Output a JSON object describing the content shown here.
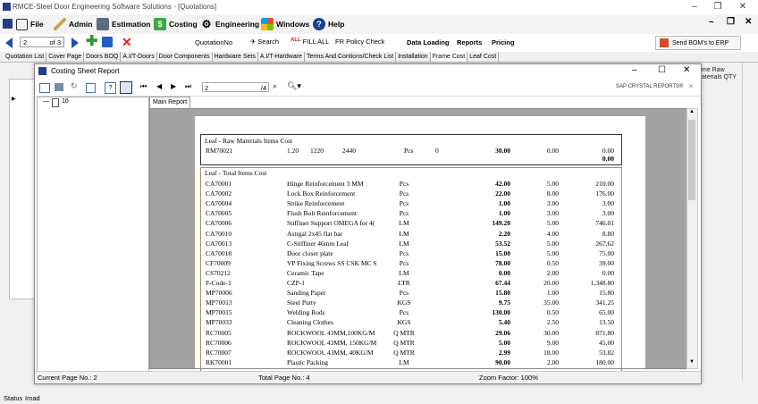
{
  "app": {
    "title": "RMCE-Steel Door Engineering Software Solutions - [Quotations]",
    "menu": [
      {
        "label": "File",
        "icon": "file-icon"
      },
      {
        "label": "Admin",
        "icon": "pen-icon"
      },
      {
        "label": "Estimation",
        "icon": "calculator-icon"
      },
      {
        "label": "Costing",
        "icon": "dollar-icon"
      },
      {
        "label": "Engineering",
        "icon": "gear-icon"
      },
      {
        "label": "Windows",
        "icon": "windows-icon"
      },
      {
        "label": "Help",
        "icon": "help-icon"
      }
    ]
  },
  "toolbar": {
    "page_value": "2",
    "page_of": "of 3",
    "quotation_label": "QuotationNo",
    "search_label": "Search",
    "fill_all_label": "FILL ALL",
    "fr_policy_label": "FR Policy Check",
    "data_loading_label": "Data Loading",
    "reports_label": "Reports",
    "pricing_label": "Pricing",
    "send_bom_label": "Send BOM's to ERP"
  },
  "tabs": [
    "Quotation List",
    "Cover Page",
    "Doors BOQ",
    "A.I/T-Doors",
    "Door Components",
    "Hardware Sets",
    "A.I/T-Hardware",
    "Terms And Contions/Check List",
    "Installation",
    "Frame Cost",
    "Leaf Cost"
  ],
  "active_tab_index": 9,
  "right_panel_text": "me Raw\naterials QTY",
  "status": {
    "label": "Status",
    "user": "Imad"
  },
  "dialog": {
    "title": "Costing Sheet Report",
    "page_value": "2",
    "page_total": "/4",
    "brand": "SAP CRYSTAL REPORTS®",
    "tree_item": "16",
    "view_tab": "Main Report",
    "status_current": "Current Page No.: 2",
    "status_total": "Total Page No.: 4",
    "status_zoom": "Zoom Factor: 100%"
  },
  "report": {
    "raw_section": {
      "title": "Leaf - Raw Materials Items Cost",
      "row": {
        "code": "RM70021",
        "w": "1.20",
        "l": "1220",
        "h": "2440",
        "unit": "Pcs",
        "n": "0",
        "qty": "30.00",
        "rate": "0.00",
        "amt": "0.00"
      },
      "total": "0.00"
    },
    "total_section": {
      "title": "Leaf - Total Items Cost",
      "rows": [
        {
          "code": "CA70001",
          "desc": "Hinge Reinforcement 3 MM",
          "unit": "Pcs",
          "qty": "42.00",
          "rate": "5.00",
          "amt": "210.00"
        },
        {
          "code": "CA70002",
          "desc": "Lock Box Reinforcement",
          "unit": "Pcs",
          "qty": "22.00",
          "rate": "8.00",
          "amt": "176.00"
        },
        {
          "code": "CA70004",
          "desc": "Strike Reinforcement",
          "unit": "Pcs",
          "qty": "1.00",
          "rate": "3.00",
          "amt": "3.00"
        },
        {
          "code": "CA70005",
          "desc": "Flush Bolt Reinforcement",
          "unit": "Pcs",
          "qty": "1.00",
          "rate": "3.00",
          "amt": "3.00"
        },
        {
          "code": "CA70006",
          "desc": "Stiffiner Support OMEGA for 4(",
          "unit": "LM",
          "qty": "149.20",
          "rate": "5.00",
          "amt": "746.01"
        },
        {
          "code": "CA70010",
          "desc": "Astrgal 2x45 flat bar",
          "unit": "LM",
          "qty": "2.20",
          "rate": "4.00",
          "amt": "8.80"
        },
        {
          "code": "CA70013",
          "desc": "C-Stiffiner 46mm Leaf",
          "unit": "LM",
          "qty": "53.52",
          "rate": "5.00",
          "amt": "267.62"
        },
        {
          "code": "CA70018",
          "desc": "Door closer plate",
          "unit": "Pcs",
          "qty": "15.00",
          "rate": "5.00",
          "amt": "75.00"
        },
        {
          "code": "CF70009",
          "desc": "VP Fixing Screws SS CSK MC S",
          "unit": "Pcs",
          "qty": "78.00",
          "rate": "0.50",
          "amt": "39.00"
        },
        {
          "code": "CS70212",
          "desc": "Ceramic Tape",
          "unit": "LM",
          "qty": "0.00",
          "rate": "2.00",
          "amt": "0.00"
        },
        {
          "code": "F-Code-1",
          "desc": "CZP-1",
          "unit": "LTR",
          "qty": "67.44",
          "rate": "20.00",
          "amt": "1,348.80"
        },
        {
          "code": "MP70006",
          "desc": "Sanding Paper",
          "unit": "Pcs",
          "qty": "15.80",
          "rate": "1.00",
          "amt": "15.80"
        },
        {
          "code": "MP70013",
          "desc": "Steel Putty",
          "unit": "KGS",
          "qty": "9.75",
          "rate": "35.00",
          "amt": "341.25"
        },
        {
          "code": "MP70015",
          "desc": "Welding Rods",
          "unit": "Pcs",
          "qty": "130.00",
          "rate": "0.50",
          "amt": "65.00"
        },
        {
          "code": "MP70033",
          "desc": "Cleaning Clothes",
          "unit": "KGS",
          "qty": "5.40",
          "rate": "2.50",
          "amt": "13.50"
        },
        {
          "code": "RC70005",
          "desc": "ROCKWOOL 43MM,100KG/M",
          "unit": "Q MTR",
          "qty": "29.06",
          "rate": "30.00",
          "amt": "871.80"
        },
        {
          "code": "RC70006",
          "desc": "ROCKWOOL 43MM, 150KG/M",
          "unit": "Q MTR",
          "qty": "5.00",
          "rate": "9.00",
          "amt": "45.00"
        },
        {
          "code": "RC70007",
          "desc": "ROCKWOOL 43MM, 40KG/M",
          "unit": "Q MTR",
          "qty": "2.99",
          "rate": "18.00",
          "amt": "53.82"
        },
        {
          "code": "RK70001",
          "desc": "Plastic Packing",
          "unit": "LM",
          "qty": "90.00",
          "rate": "2.00",
          "amt": "180.00"
        }
      ]
    }
  }
}
